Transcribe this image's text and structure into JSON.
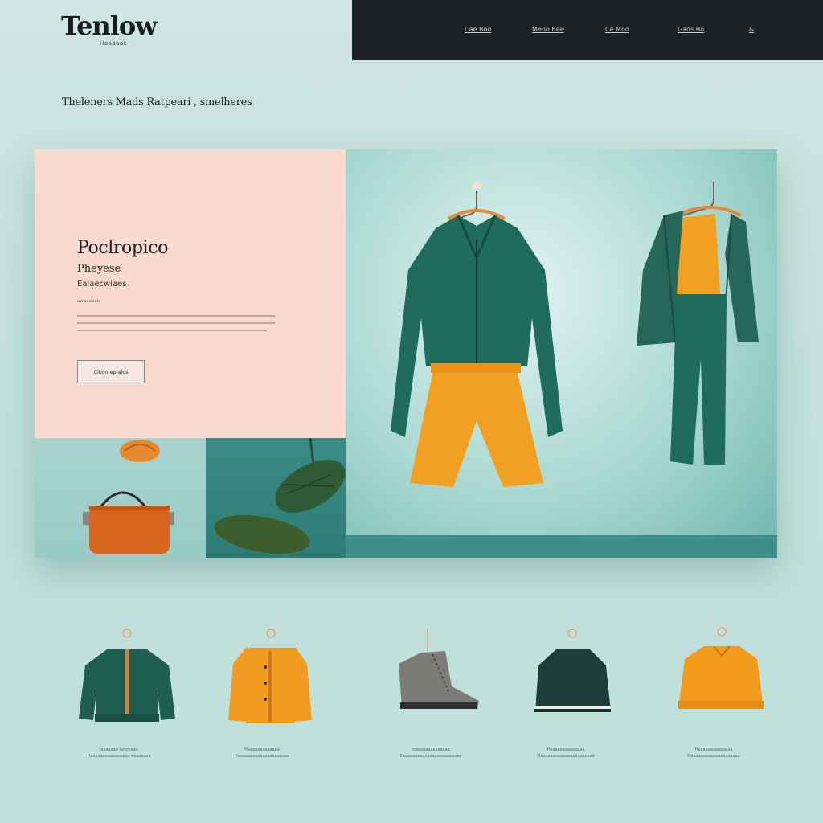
{
  "brand": {
    "name": "Tenlow",
    "tagline": "Haaaaac"
  },
  "nav": {
    "items": [
      "Cae Boo",
      "Meno Bee",
      "Ce Moo",
      "Gaos Bo",
      "&"
    ]
  },
  "page_tagline": "Theleners Mads Ratpeari , smelheres",
  "hero": {
    "title": "Poclropico",
    "subtitle": "Pheyese",
    "subtitle2": "Eaiaecwiaes",
    "meta": "awaaaaais",
    "button_label": "Clkon eplalos"
  },
  "products": [
    {
      "name": "green-jacket",
      "caption1": "laaaaaaa lammaaa",
      "caption2": "Haaaaaaaaaaaaaaaa aaaaaaaa"
    },
    {
      "name": "orange-cardigan",
      "caption1": "Haaaaaaaaaaaaa",
      "caption2": "Haaaaaaaaaaaaaaaaaaaaa"
    },
    {
      "name": "grey-boot",
      "caption1": "maaaaaaaaaaaaaa",
      "caption2": "Eaaaaaaaaaaaaaaaaaaaaaaaa"
    },
    {
      "name": "dark-green-top",
      "caption1": "Haaaaaaaaaaaaaa",
      "caption2": "Maaaaaaaaaaaaaaaaaaaaaa"
    },
    {
      "name": "orange-polo",
      "caption1": "Haaaaaaaaaaaaaa",
      "caption2": "Maaaaaaaaaaaaaaaaaaaa"
    }
  ],
  "colors": {
    "accent": "#f0a020",
    "brand_green": "#1f6b5c",
    "navbar": "#1f2224",
    "card": "#fad9cf",
    "background": "#c4e1dc"
  }
}
